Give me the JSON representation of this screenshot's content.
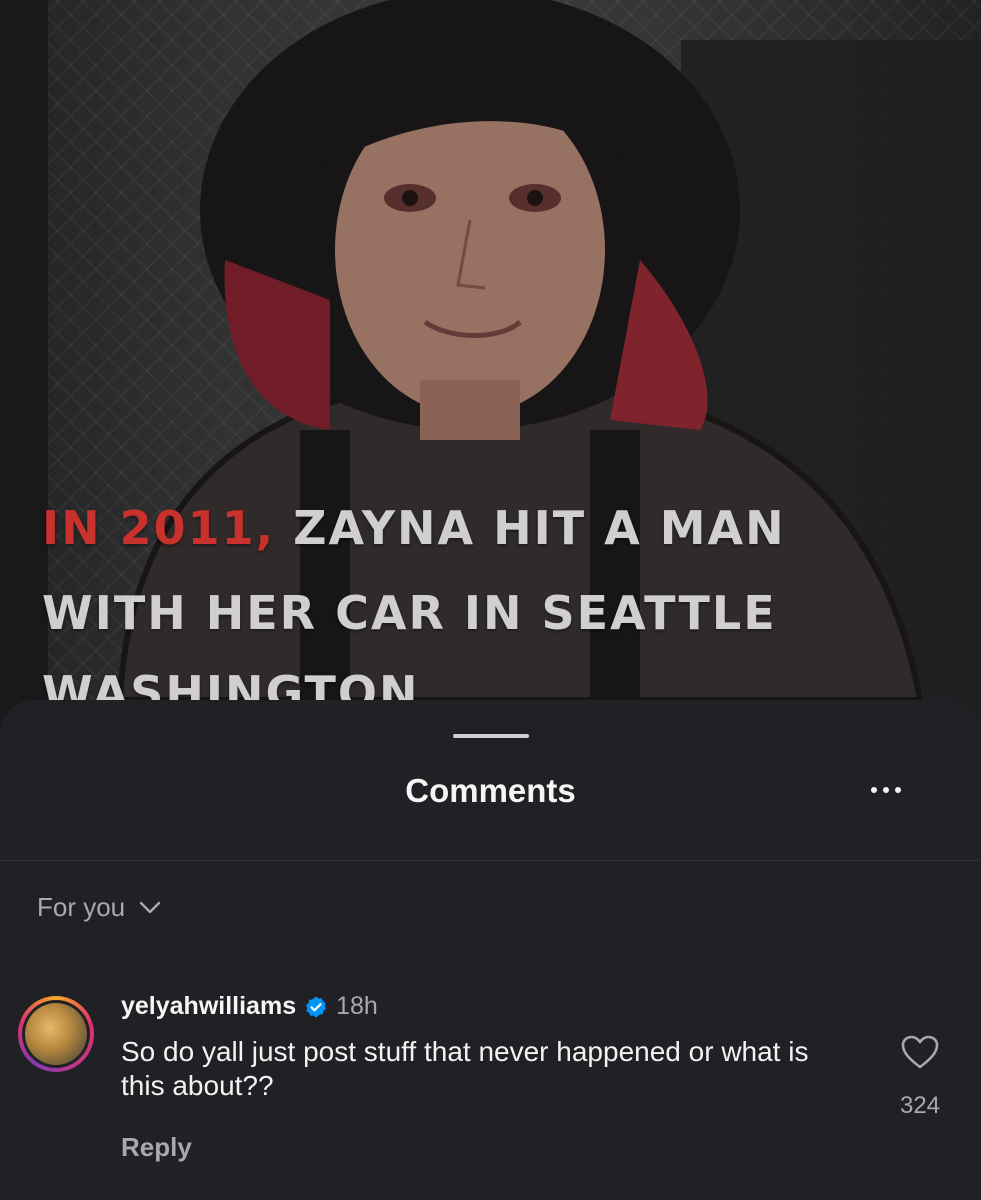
{
  "post": {
    "overlay_line1_red": "IN 2011,",
    "overlay_line1_rest": " ZAYNA HIT A MAN",
    "overlay_line2": "WITH HER CAR IN SEATTLE",
    "overlay_line3": "WASHINGTON"
  },
  "sheet": {
    "title": "Comments",
    "more_icon": "more-horizontal-icon",
    "filter_label": "For you",
    "filter_icon": "chevron-down-icon"
  },
  "comments": [
    {
      "username": "yelyahwilliams",
      "verified": true,
      "time": "18h",
      "text": "So do yall just post stuff that never happened or what is this about??",
      "reply_label": "Reply",
      "likes": "324",
      "like_icon": "heart-outline-icon"
    }
  ],
  "colors": {
    "sheet_bg": "#202124",
    "accent_red": "#c8312c",
    "verified_blue": "#0095f6",
    "muted_text": "#a8a9ad"
  }
}
